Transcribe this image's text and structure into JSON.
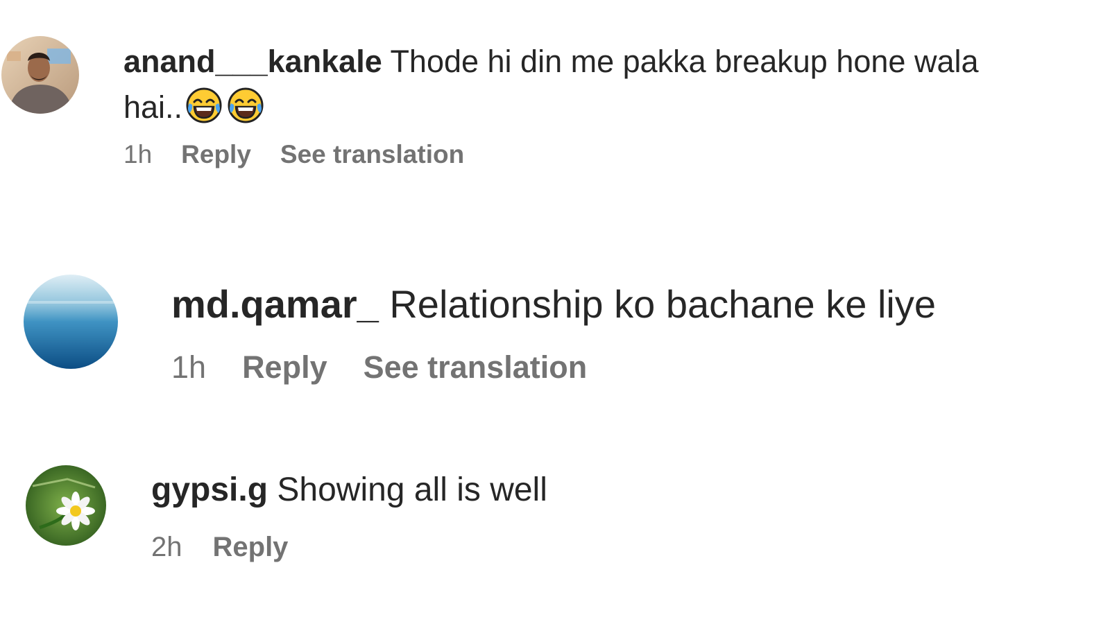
{
  "comments": [
    {
      "avatar": "user-photo-avatar",
      "username": "anand___kankale",
      "text": "Thode hi din me pakka breakup hone wala hai..",
      "emojis": [
        "face-with-tears-of-joy-icon",
        "face-with-tears-of-joy-icon"
      ],
      "time": "1h",
      "reply_label": "Reply",
      "translate_label": "See translation"
    },
    {
      "avatar": "ocean-photo-avatar",
      "username": "md.qamar_",
      "text": "Relationship ko bachane ke liye",
      "time": "1h",
      "reply_label": "Reply",
      "translate_label": "See translation"
    },
    {
      "avatar": "flower-photo-avatar",
      "username": "gypsi.g",
      "text": "Showing all is well",
      "time": "2h",
      "reply_label": "Reply"
    }
  ],
  "colors": {
    "text": "#262626",
    "meta": "#737373",
    "background": "#ffffff"
  }
}
